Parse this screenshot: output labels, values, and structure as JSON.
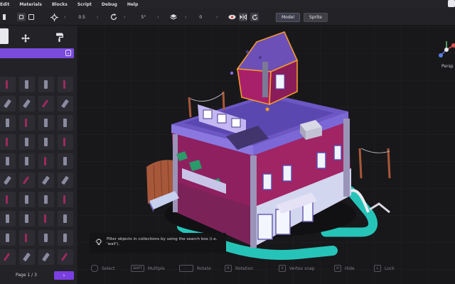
{
  "menu": {
    "items": [
      "Edit",
      "Materials",
      "Blocks",
      "Script",
      "Debug",
      "Help"
    ]
  },
  "toolbar": {
    "move_value": "0.5",
    "rotate_value": "5°",
    "layer_value": "0",
    "model_label": "Model",
    "sprite_label": "Sprite"
  },
  "left_panel": {
    "pager_text": "Page 1 / 3",
    "next_label": "›"
  },
  "tooltip": {
    "text": "Filter objects in collections by using the search box (i.e. 'wall')."
  },
  "hints": {
    "select": "Select",
    "multiple_key": "SHIFT",
    "multiple": "Multiple",
    "rotate": "Rotate",
    "rotate_key": "R",
    "rotation": "Rotation",
    "vertex_key": "V",
    "vertex_snap": "Vertex snap",
    "hide_key": "H",
    "hide": "Hide",
    "lock_key": "L",
    "lock": "Lock"
  },
  "gizmo": {
    "label": "Persp"
  },
  "colors": {
    "accent": "#7a3fe0",
    "selection": "#f39a2c",
    "house_purple": "#7b5fd0",
    "house_magenta": "#9a1f5a",
    "path_teal": "#26c4b8"
  }
}
